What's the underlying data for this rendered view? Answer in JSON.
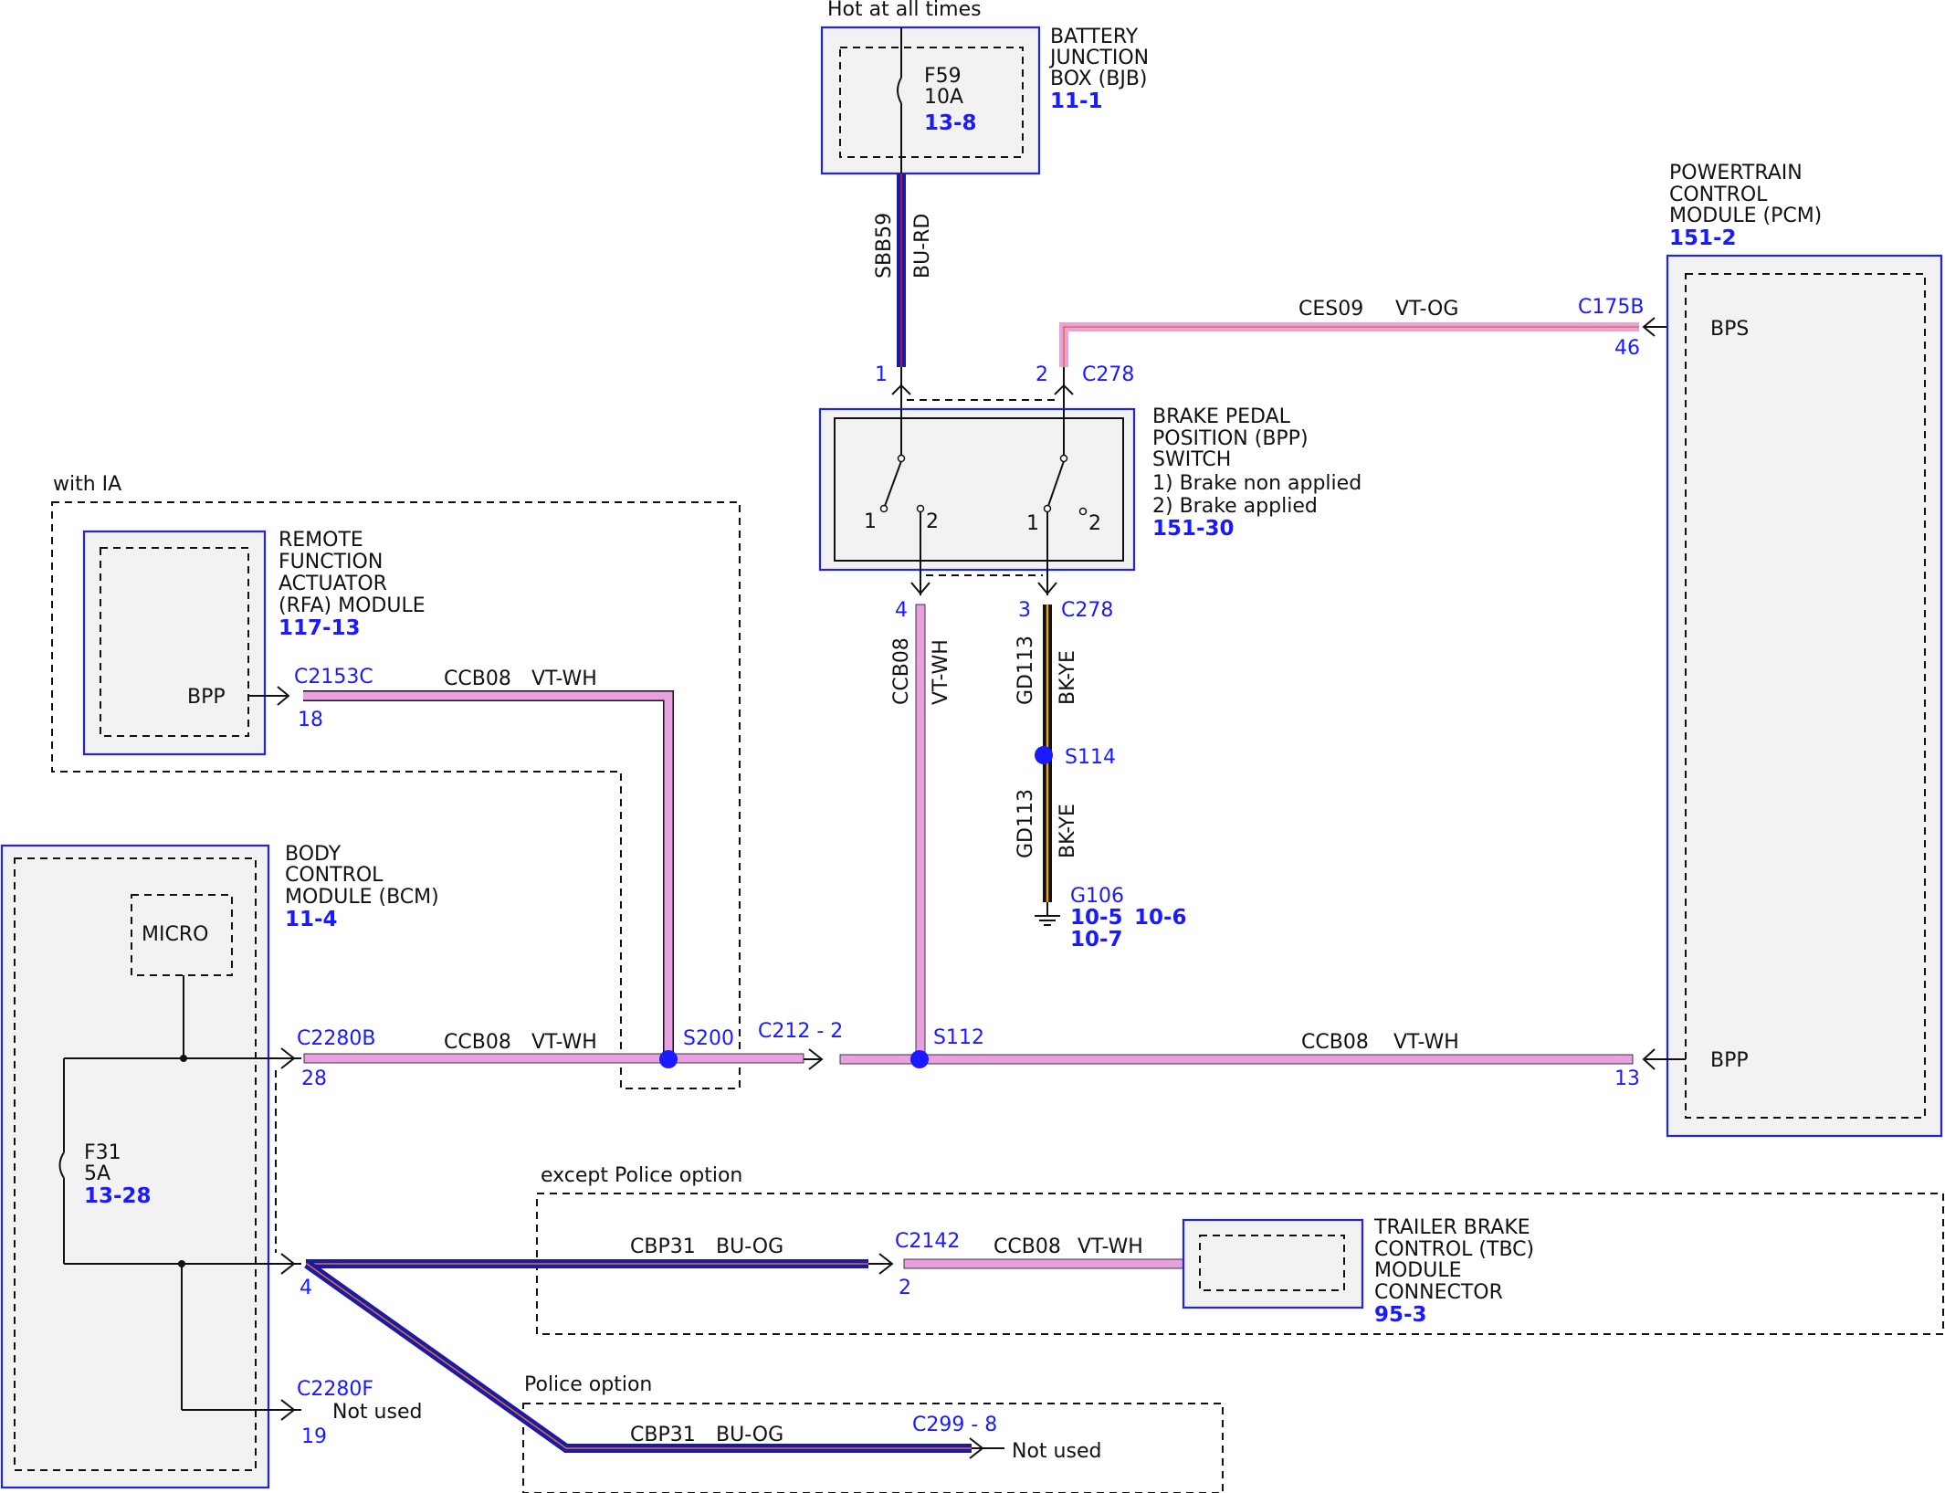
{
  "header": {
    "hot_label": "Hot at all times"
  },
  "bjb": {
    "title_lines": [
      "BATTERY",
      "JUNCTION",
      "BOX (BJB)"
    ],
    "ref": "11-1",
    "fuse_name": "F59",
    "fuse_rating": "10A",
    "fuse_ref": "13-8"
  },
  "pcm": {
    "title_lines": [
      "POWERTRAIN",
      "CONTROL",
      "MODULE (PCM)"
    ],
    "ref": "151-2",
    "pin_bps": "BPS",
    "pin_bpp": "BPP"
  },
  "bpp_switch": {
    "title_lines": [
      "BRAKE PEDAL",
      "POSITION (BPP)",
      "SWITCH",
      "1) Brake non applied",
      "2) Brake applied"
    ],
    "ref": "151-30",
    "pos1_a": "1",
    "pos2_a": "2",
    "pos1_b": "1",
    "pos2_b": "2"
  },
  "ia": {
    "label": "with IA"
  },
  "rfa": {
    "title_lines": [
      "REMOTE",
      "FUNCTION",
      "ACTUATOR",
      "(RFA) MODULE"
    ],
    "ref": "117-13",
    "pin": "BPP"
  },
  "bcm": {
    "title_lines": [
      "BODY",
      "CONTROL",
      "MODULE (BCM)"
    ],
    "ref": "11-4",
    "micro": "MICRO",
    "fuse_name": "F31",
    "fuse_rating": "5A",
    "fuse_ref": "13-28"
  },
  "tbc": {
    "title_lines": [
      "TRAILER BRAKE",
      "CONTROL (TBC)",
      "MODULE",
      "CONNECTOR"
    ],
    "ref": "95-3"
  },
  "options": {
    "except_police": "except Police option",
    "police": "Police option"
  },
  "connectors": {
    "c278_top": "C278",
    "c278_top_pin1": "1",
    "c278_top_pin2": "2",
    "c278_bot": "C278",
    "c278_bot_pin4": "4",
    "c278_bot_pin3": "3",
    "c175b": "C175B",
    "c175b_pin46": "46",
    "c175b_pin13": "13",
    "c2153c": "C2153C",
    "c2153c_pin": "18",
    "c2280b": "C2280B",
    "c2280b_pin": "28",
    "c2280b_pin4": "4",
    "c2280f": "C2280F",
    "c2280f_pin": "19",
    "c212": "C212 - 2",
    "c2142": "C2142",
    "c2142_pin": "2",
    "c299": "C299 - 8"
  },
  "splices": {
    "s200": "S200",
    "s112": "S112",
    "s114": "S114"
  },
  "ground": {
    "name": "G106",
    "refs": [
      "10-5",
      "10-6",
      "10-7"
    ]
  },
  "wires": {
    "sbb59": {
      "circuit": "SBB59",
      "color": "BU-RD"
    },
    "ces09": {
      "circuit": "CES09",
      "color": "VT-OG"
    },
    "ccb08_rfa": {
      "circuit": "CCB08",
      "color": "VT-WH"
    },
    "ccb08_bcm": {
      "circuit": "CCB08",
      "color": "VT-WH"
    },
    "ccb08_pcm": {
      "circuit": "CCB08",
      "color": "VT-WH"
    },
    "ccb08_vert": {
      "circuit": "CCB08",
      "color": "VT-WH"
    },
    "gd113_a": {
      "circuit": "GD113",
      "color": "BK-YE"
    },
    "gd113_b": {
      "circuit": "GD113",
      "color": "BK-YE"
    },
    "cbp31_tbc": {
      "circuit": "CBP31",
      "color": "BU-OG"
    },
    "ccb08_tbc": {
      "circuit": "CCB08",
      "color": "VT-WH"
    },
    "cbp31_police": {
      "circuit": "CBP31",
      "color": "BU-OG"
    }
  },
  "not_used_1": "Not used",
  "not_used_2": "Not used",
  "colors": {
    "module_border": "#2222ee",
    "label_blue": "#1a1aff",
    "wire_vt": "#e8a0e0",
    "wire_bu": "#1a1aa8",
    "wire_bk": "#111111",
    "wire_ye": "#e8a020",
    "wire_og": "#e07030",
    "wire_rd": "#cc2020"
  }
}
